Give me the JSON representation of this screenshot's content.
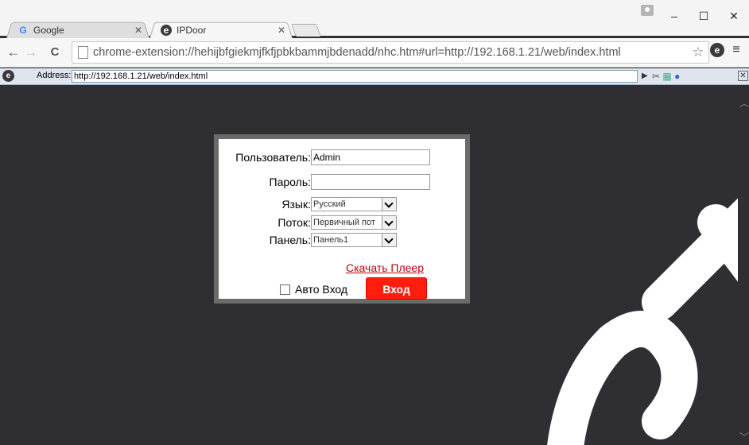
{
  "browser": {
    "tabs": [
      {
        "label": "Google",
        "favicon": "G",
        "active": false
      },
      {
        "label": "IPDoor",
        "favicon": "e",
        "active": true
      }
    ],
    "window_controls": {
      "minimize": "–",
      "maximize": "☐",
      "close": "✕"
    },
    "nav": {
      "back": "←",
      "forward": "→",
      "reload": "C"
    },
    "url": "chrome-extension://hehijbfgiekmjfkfjpbkbammjbdenadd/nhc.htm#url=http://192.168.1.21/web/index.html",
    "star": "☆",
    "menu": "≡"
  },
  "iebar": {
    "label": "Address:",
    "value": "http://192.168.1.21/web/index.html",
    "go": "▶",
    "tools": "✂",
    "close": "✕"
  },
  "login": {
    "user_label": "Пользователь:",
    "user_value": "Admin",
    "password_label": "Пароль:",
    "password_value": "",
    "language_label": "Язык:",
    "language_value": "Русский",
    "stream_label": "Поток:",
    "stream_value": "Первичный пот",
    "panel_label": "Панель:",
    "panel_value": "Панель1",
    "download_link": "Скачать Плеер",
    "auto_login_label": "Авто Вход",
    "login_button": "Вход"
  }
}
